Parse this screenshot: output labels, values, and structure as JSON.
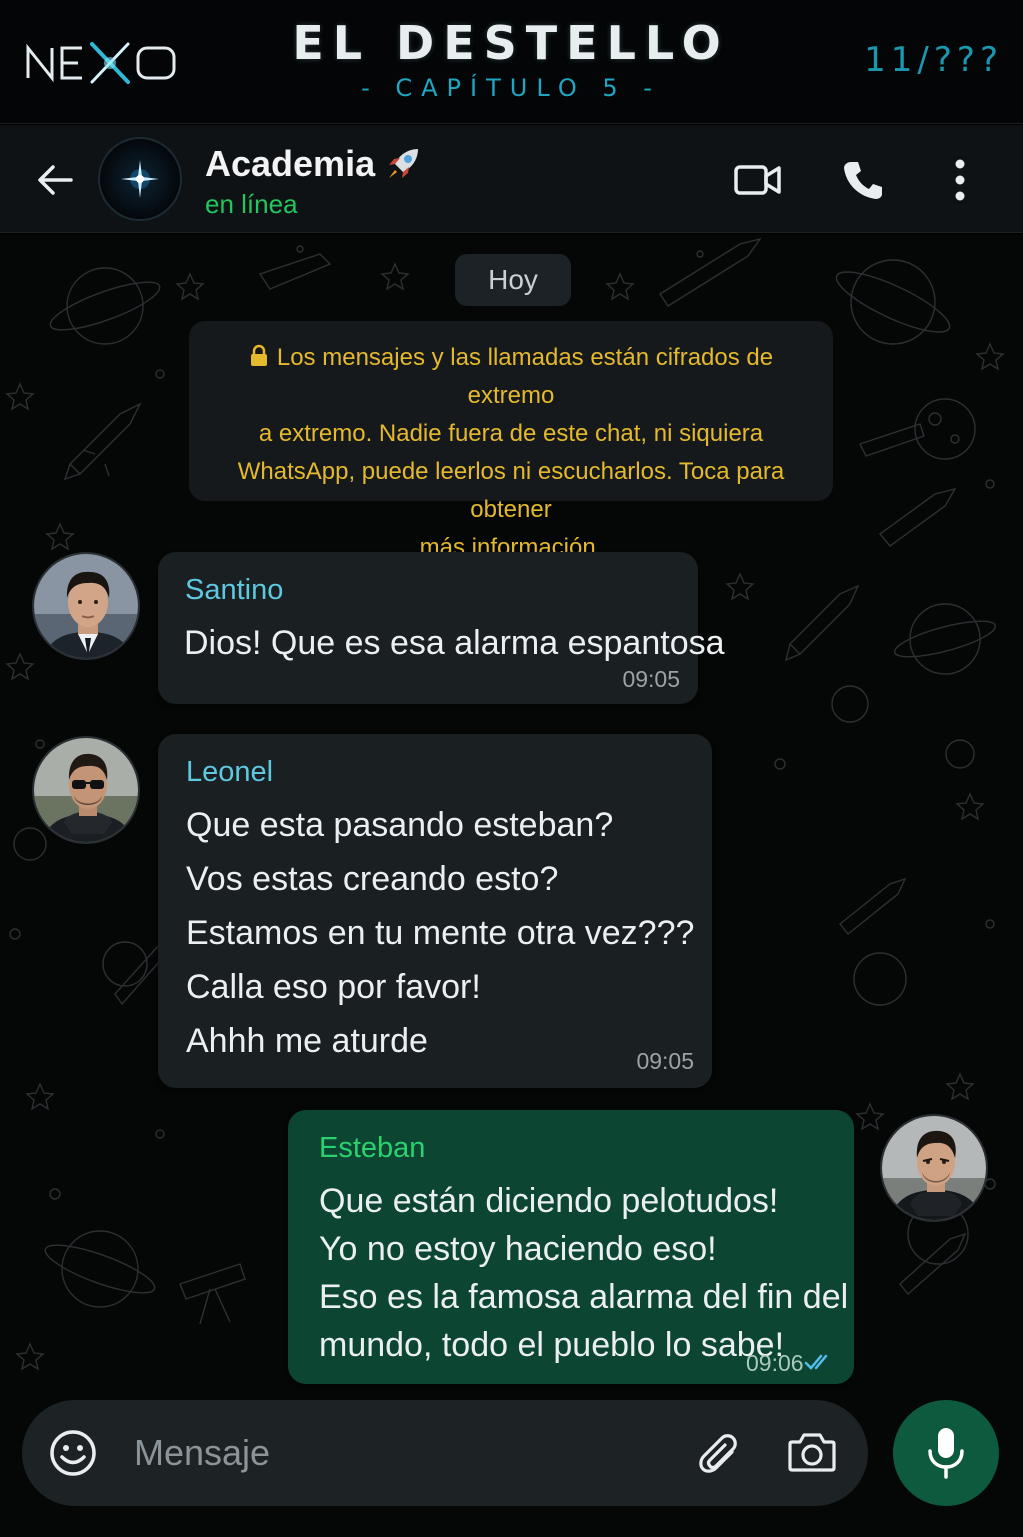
{
  "banner": {
    "logo": "NEXO",
    "title": "EL DESTELLO",
    "subtitle": "- CAPÍTULO 5 -",
    "counter": "11/???"
  },
  "header": {
    "chat_name": "Academia",
    "status": "en línea",
    "icons": [
      "back-arrow-icon",
      "video-call-icon",
      "phone-icon",
      "more-options-icon"
    ]
  },
  "chat": {
    "date_chip": "Hoy",
    "encryption_notice": [
      "Los mensajes y las llamadas están cifrados de extremo",
      "a extremo. Nadie fuera de este chat, ni siquiera",
      "WhatsApp, puede leerlos ni escucharlos. Toca para obtener",
      "más información."
    ],
    "messages": [
      {
        "sender": "Santino",
        "lines": [
          "Dios! Que es esa alarma espantosa"
        ],
        "time": "09:05",
        "direction": "incoming"
      },
      {
        "sender": "Leonel",
        "lines": [
          "Que esta pasando esteban?",
          "Vos estas creando esto?",
          "Estamos en tu mente otra vez???",
          "Calla eso por favor!",
          "Ahhh me aturde"
        ],
        "time": "09:05",
        "direction": "incoming"
      },
      {
        "sender": "Esteban",
        "lines": [
          "Que están diciendo pelotudos!",
          "Yo no estoy haciendo eso!",
          "Eso es la famosa alarma del fin del",
          "mundo, todo el pueblo lo sabe!"
        ],
        "time": "09:06",
        "direction": "outgoing",
        "read": true
      }
    ]
  },
  "input": {
    "placeholder": "Mensaje"
  },
  "colors": {
    "sender_incoming": "#5ec8e0",
    "sender_outgoing": "#2bd16f",
    "outgoing_bubble": "#0c4633",
    "notice_text": "#e5b92d",
    "online_status": "#22c55e",
    "read_ticks": "#53bdeb"
  }
}
